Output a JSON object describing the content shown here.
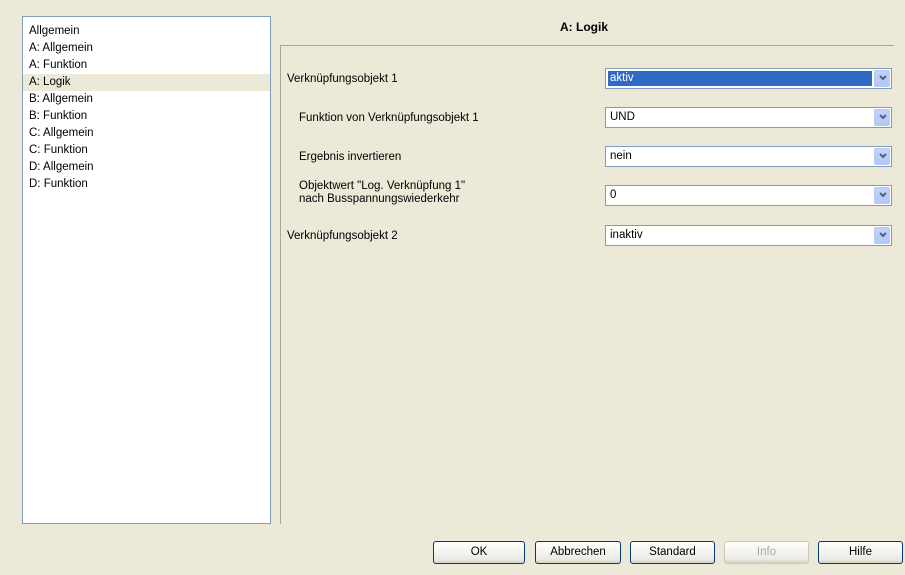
{
  "nav": {
    "items": [
      {
        "label": "Allgemein"
      },
      {
        "label": "A: Allgemein"
      },
      {
        "label": "A: Funktion"
      },
      {
        "label": "A: Logik"
      },
      {
        "label": "B: Allgemein"
      },
      {
        "label": "B: Funktion"
      },
      {
        "label": "C: Allgemein"
      },
      {
        "label": "C: Funktion"
      },
      {
        "label": "D: Allgemein"
      },
      {
        "label": "D: Funktion"
      }
    ],
    "selected": "A: Logik"
  },
  "section": {
    "title": "A: Logik"
  },
  "params": [
    {
      "label": "Verknüpfungsobjekt 1",
      "value": "aktiv"
    },
    {
      "label": "Funktion von Verknüpfungsobjekt 1",
      "value": "UND"
    },
    {
      "label": "Ergebnis invertieren",
      "value": "nein"
    },
    {
      "label_line1": "Objektwert \"Log. Verknüpfung 1\"",
      "label_line2": "nach Busspannungswiederkehr",
      "value": "0"
    },
    {
      "label": "Verknüpfungsobjekt 2",
      "value": "inaktiv"
    }
  ],
  "buttons": {
    "ok": "OK",
    "cancel": "Abbrechen",
    "standard": "Standard",
    "info": "Info",
    "help": "Hilfe"
  },
  "colors": {
    "background": "#ece9d8",
    "selection": "#316ac5",
    "combo_border": "#7f9db9"
  }
}
